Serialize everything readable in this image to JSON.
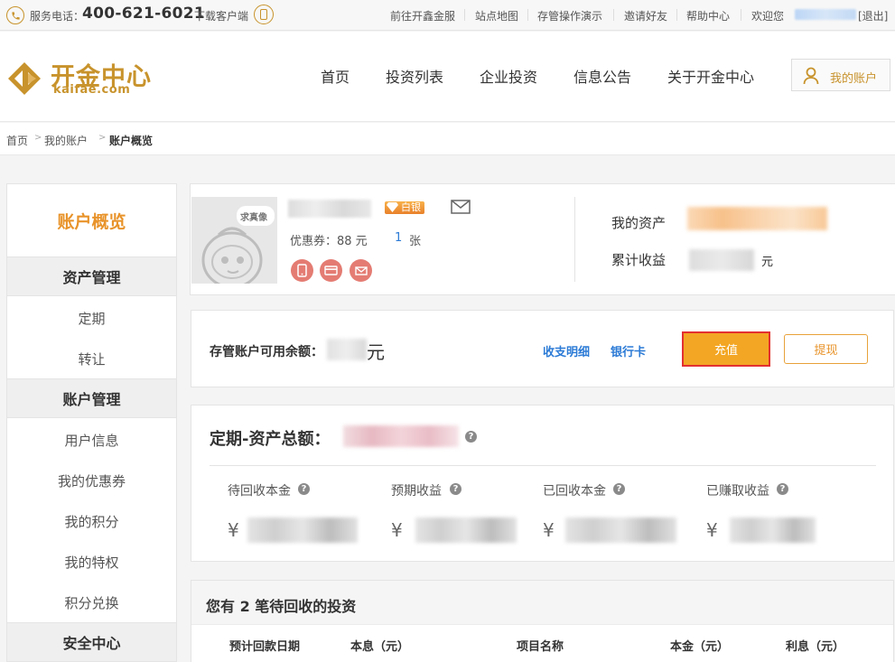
{
  "topbar": {
    "phone_label": "服务电话：",
    "phone_number": "400-621-6021",
    "download": "下载客户端",
    "links": [
      "前往开鑫金服",
      "站点地图",
      "存管操作演示",
      "邀请好友",
      "帮助中心"
    ],
    "welcome": "欢迎您",
    "logout": "[退出]"
  },
  "header": {
    "logo_cn": "开金中心",
    "logo_en": "kaifae.com",
    "nav": [
      "首页",
      "投资列表",
      "企业投资",
      "信息公告",
      "关于开金中心"
    ],
    "account_button": "我的账户"
  },
  "breadcrumb": [
    "首页",
    "我的账户",
    "账户概览"
  ],
  "sidebar": {
    "title": "账户概览",
    "group_assets": "资产管理",
    "item_fixed": "定期",
    "item_transfer": "转让",
    "group_account": "账户管理",
    "item_userinfo": "用户信息",
    "item_coupons": "我的优惠券",
    "item_points": "我的积分",
    "item_privileges": "我的特权",
    "item_redeem": "积分兑换",
    "group_security": "安全中心"
  },
  "profile": {
    "avatar_text": "求真像",
    "badge": "白银",
    "coupon_text": "优惠券：88 元",
    "coupon_count": "1",
    "coupon_unit": "张",
    "my_assets_label": "我的资产",
    "total_income_label": "累计收益",
    "income_unit": "元"
  },
  "balance": {
    "label": "存管账户可用余额：",
    "unit": "元",
    "link_details": "收支明细",
    "link_bank": "银行卡",
    "recharge": "充值",
    "withdraw": "提现"
  },
  "totals": {
    "title": "定期-资产总额：",
    "help": "?",
    "columns": [
      "待回收本金",
      "预期收益",
      "已回收本金",
      "已赚取收益"
    ],
    "currency": "¥"
  },
  "pending": {
    "title": "您有 2 笔待回收的投资",
    "headers": [
      "预计回款日期",
      "本息（元）",
      "项目名称",
      "本金（元）",
      "利息（元）"
    ]
  },
  "colors": {
    "brand_gold": "#c8932c",
    "accent_orange": "#f3a623",
    "link_blue": "#2c7bd6",
    "highlight_red": "#e33030"
  }
}
